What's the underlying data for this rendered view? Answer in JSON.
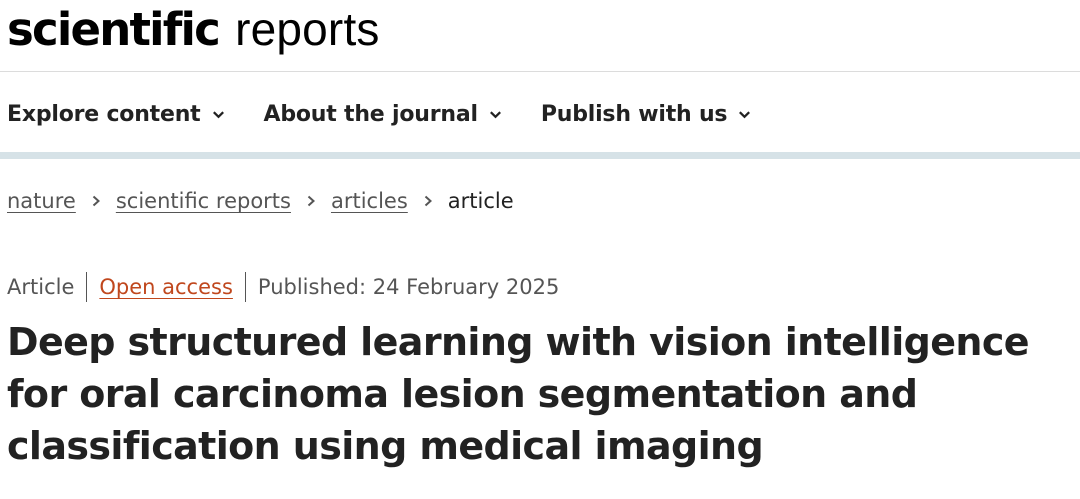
{
  "header": {
    "logo_bold": "scientific",
    "logo_light": "reports"
  },
  "nav": {
    "items": [
      {
        "label": "Explore content"
      },
      {
        "label": "About the journal"
      },
      {
        "label": "Publish with us"
      }
    ]
  },
  "breadcrumb": {
    "items": [
      "nature",
      "scientific reports",
      "articles"
    ],
    "current": "article"
  },
  "article": {
    "type": "Article",
    "access": "Open access",
    "published": "Published: 24 February 2025",
    "title": "Deep structured learning with vision intelligence for oral carcinoma lesion segmentation and classification using medical imaging"
  },
  "colors": {
    "accent_link": "#c0471d",
    "nav_bar": "#d6e2e7",
    "text": "#222222"
  },
  "icons": {
    "nav_chevron": "chevron-down-icon",
    "breadcrumb_separator": "chevron-right-icon"
  }
}
